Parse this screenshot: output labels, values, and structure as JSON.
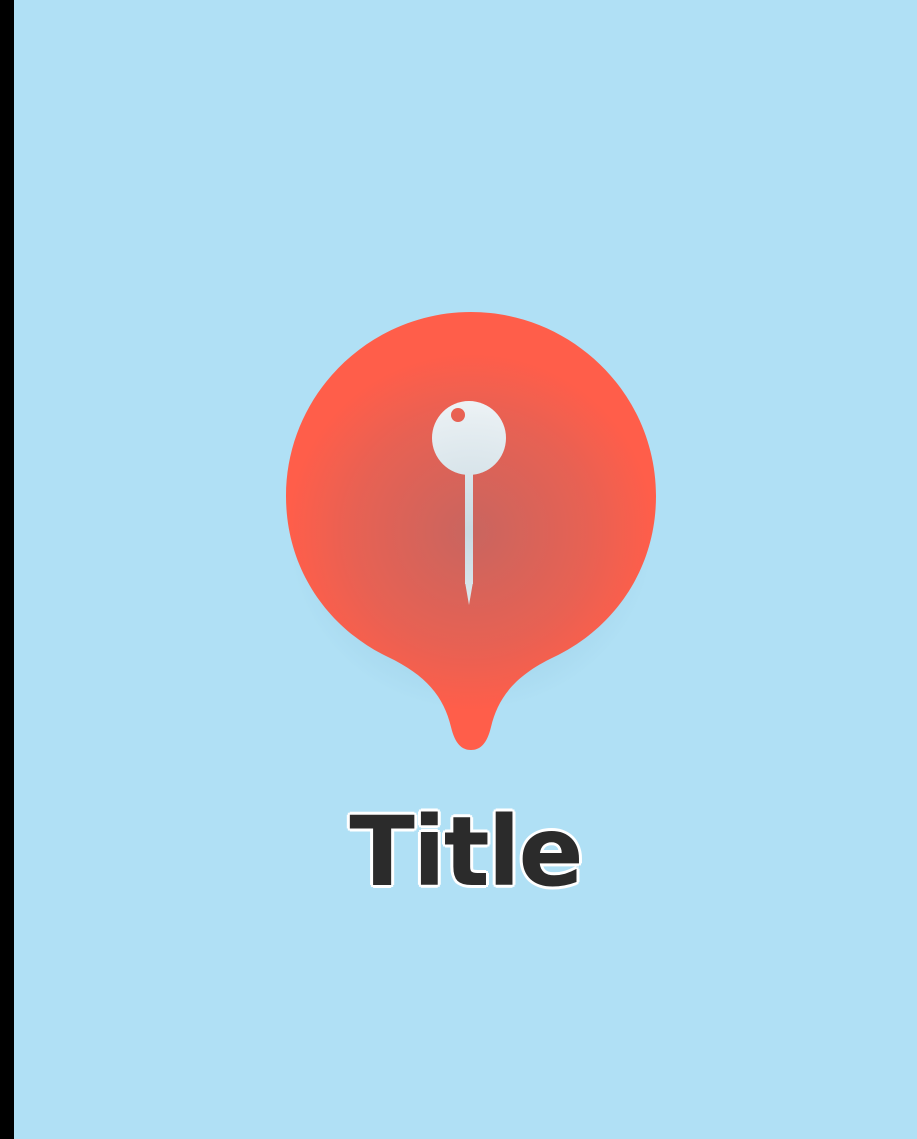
{
  "map": {
    "background_color": "#B0E0F5"
  },
  "marker": {
    "icon": "pushpin-icon",
    "fill_color": "#FF5E4A",
    "icon_color": "#FFFFFF",
    "label": "Title",
    "label_color": "#2B2B2B"
  }
}
